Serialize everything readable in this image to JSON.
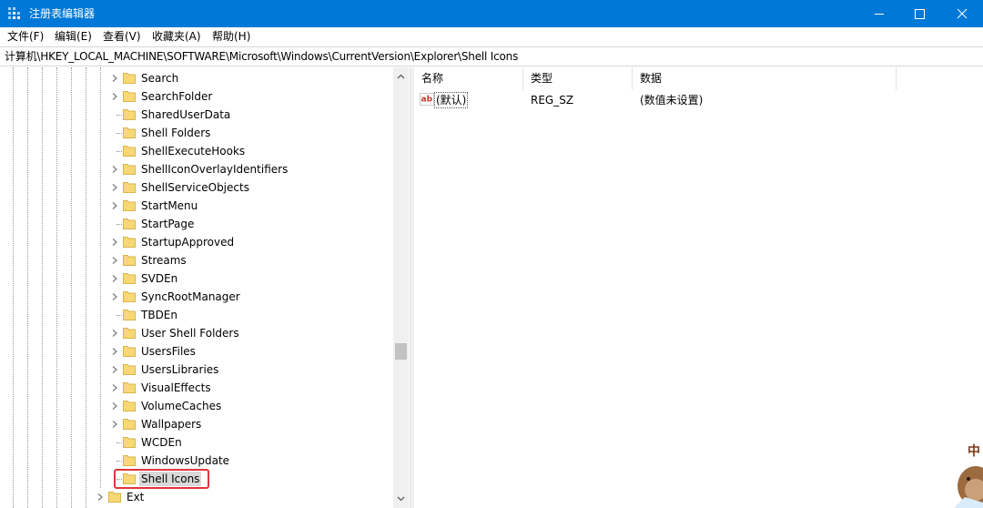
{
  "window": {
    "title": "注册表编辑器",
    "controls": {
      "minimize": "minimize",
      "maximize": "maximize",
      "close": "close"
    }
  },
  "menu": [
    "文件(F)",
    "编辑(E)",
    "查看(V)",
    "收藏夹(A)",
    "帮助(H)"
  ],
  "address": "计算机\\HKEY_LOCAL_MACHINE\\SOFTWARE\\Microsoft\\Windows\\CurrentVersion\\Explorer\\Shell Icons",
  "tree": {
    "items": [
      {
        "label": "Search",
        "expandable": true
      },
      {
        "label": "SearchFolder",
        "expandable": true
      },
      {
        "label": "SharedUserData",
        "expandable": false
      },
      {
        "label": "Shell Folders",
        "expandable": false
      },
      {
        "label": "ShellExecuteHooks",
        "expandable": false
      },
      {
        "label": "ShellIconOverlayIdentifiers",
        "expandable": true
      },
      {
        "label": "ShellServiceObjects",
        "expandable": true
      },
      {
        "label": "StartMenu",
        "expandable": true
      },
      {
        "label": "StartPage",
        "expandable": false
      },
      {
        "label": "StartupApproved",
        "expandable": true
      },
      {
        "label": "Streams",
        "expandable": true
      },
      {
        "label": "SVDEn",
        "expandable": true
      },
      {
        "label": "SyncRootManager",
        "expandable": true
      },
      {
        "label": "TBDEn",
        "expandable": false
      },
      {
        "label": "User Shell Folders",
        "expandable": true
      },
      {
        "label": "UsersFiles",
        "expandable": true
      },
      {
        "label": "UsersLibraries",
        "expandable": true
      },
      {
        "label": "VisualEffects",
        "expandable": true
      },
      {
        "label": "VolumeCaches",
        "expandable": true
      },
      {
        "label": "Wallpapers",
        "expandable": true
      },
      {
        "label": "WCDEn",
        "expandable": false
      },
      {
        "label": "WindowsUpdate",
        "expandable": false
      },
      {
        "label": "Shell Icons",
        "expandable": false,
        "selected": true
      },
      {
        "label": "Ext",
        "expandable": true
      }
    ]
  },
  "list": {
    "columns": [
      "名称",
      "类型",
      "数据"
    ],
    "rows": [
      {
        "name": "(默认)",
        "type": "REG_SZ",
        "data": "(数值未设置)",
        "icon": "string-value-icon"
      }
    ]
  },
  "colors": {
    "titlebar": "#0078d7",
    "folder": "#f8d775",
    "highlight": "#e0353f",
    "selection": "#d9d9d9"
  }
}
